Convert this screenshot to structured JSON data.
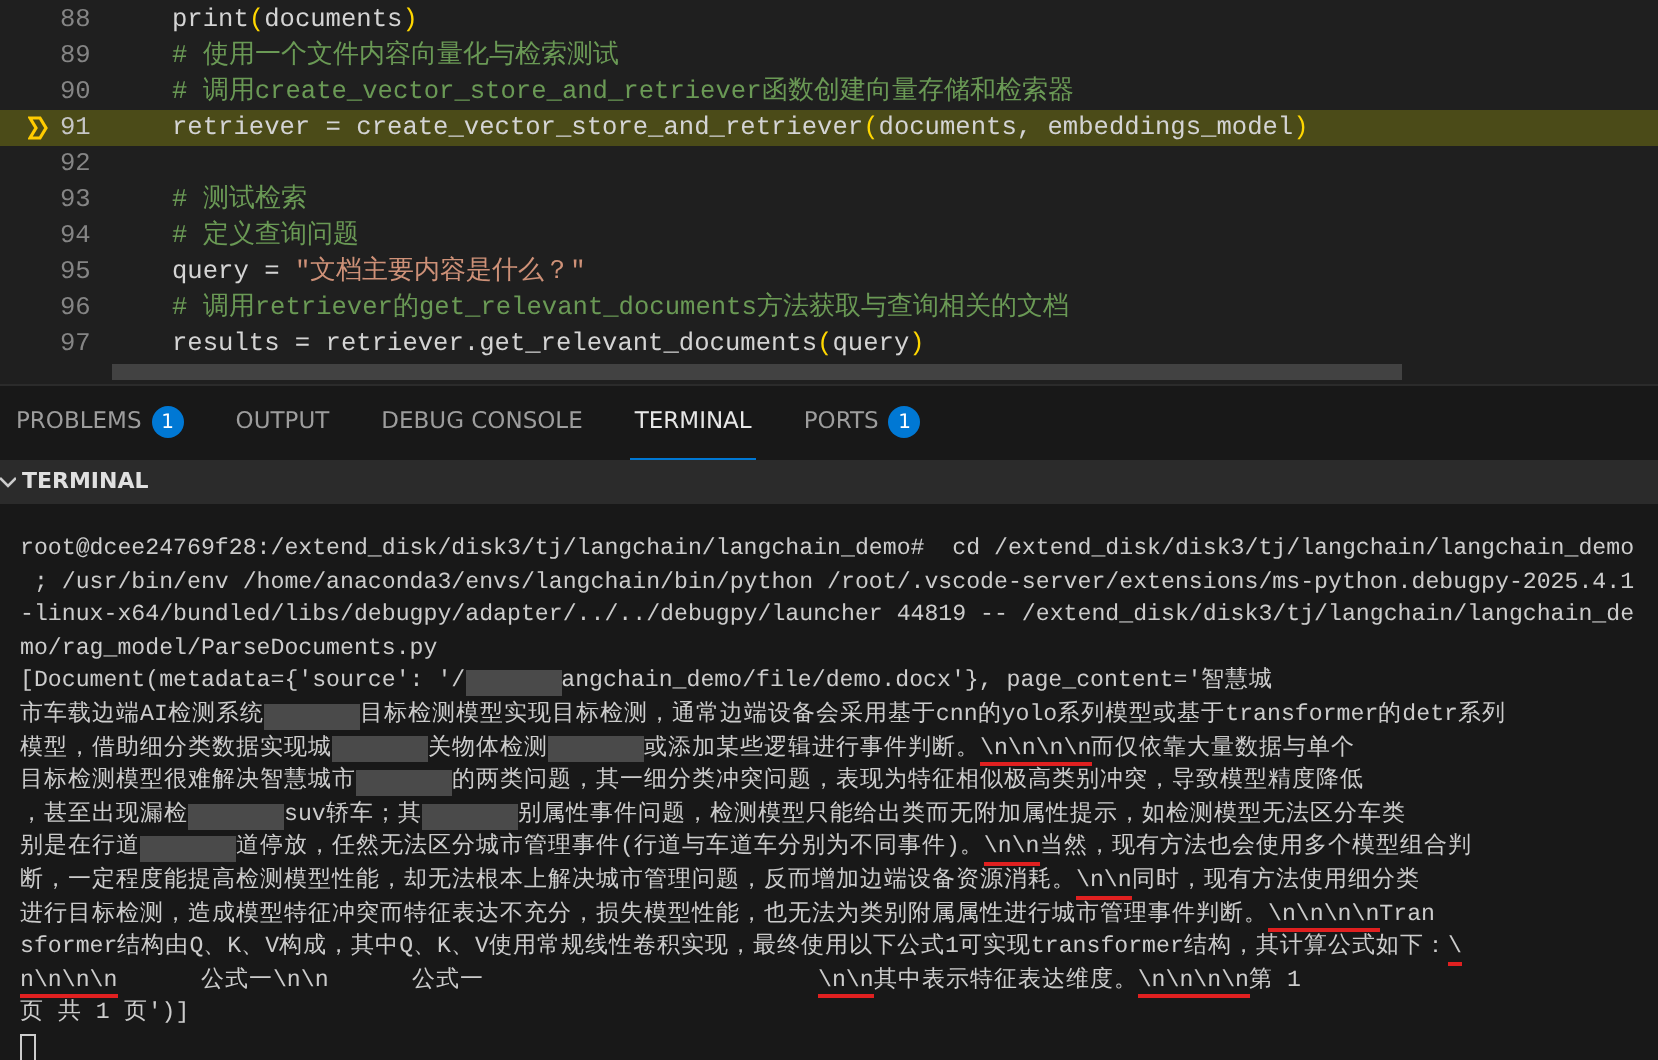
{
  "editor": {
    "lines": [
      {
        "number": "88",
        "current": false,
        "tokens": [
          {
            "kind": "plain",
            "text": "print"
          },
          {
            "kind": "paren",
            "text": "("
          },
          {
            "kind": "plain",
            "text": "documents"
          },
          {
            "kind": "paren",
            "text": ")"
          }
        ]
      },
      {
        "number": "89",
        "current": false,
        "tokens": [
          {
            "kind": "comment",
            "text": "# 使用一个文件内容向量化与检索测试"
          }
        ]
      },
      {
        "number": "90",
        "current": false,
        "tokens": [
          {
            "kind": "comment",
            "text": "# 调用create_vector_store_and_retriever函数创建向量存储和检索器"
          }
        ]
      },
      {
        "number": "91",
        "current": true,
        "tokens": [
          {
            "kind": "plain",
            "text": "retriever = create_vector_store_and_retriever"
          },
          {
            "kind": "paren",
            "text": "("
          },
          {
            "kind": "plain",
            "text": "documents, embeddings_model"
          },
          {
            "kind": "paren",
            "text": ")"
          }
        ]
      },
      {
        "number": "92",
        "current": false
      },
      {
        "number": "93",
        "current": false,
        "tokens": [
          {
            "kind": "comment",
            "text": "# 测试检索"
          }
        ]
      },
      {
        "number": "94",
        "current": false,
        "tokens": [
          {
            "kind": "comment",
            "text": "# 定义查询问题"
          }
        ]
      },
      {
        "number": "95",
        "current": false,
        "tokens": [
          {
            "kind": "plain",
            "text": "query = "
          },
          {
            "kind": "string",
            "text": "\"文档主要内容是什么？\""
          }
        ]
      },
      {
        "number": "96",
        "current": false,
        "tokens": [
          {
            "kind": "comment",
            "text": "# 调用retriever的get_relevant_documents方法获取与查询相关的文档"
          }
        ]
      },
      {
        "number": "97",
        "current": false,
        "tokens": [
          {
            "kind": "plain",
            "text": "results = retriever.get_relevant_documents"
          },
          {
            "kind": "paren",
            "text": "("
          },
          {
            "kind": "plain",
            "text": "query"
          },
          {
            "kind": "paren",
            "text": ")"
          }
        ]
      }
    ]
  },
  "panel_tabs": [
    {
      "label": "PROBLEMS",
      "badge": "1",
      "selected": false
    },
    {
      "label": "OUTPUT",
      "selected": false
    },
    {
      "label": "DEBUG CONSOLE",
      "selected": false
    },
    {
      "label": "TERMINAL",
      "selected": true
    },
    {
      "label": "PORTS",
      "badge": "1",
      "selected": false
    }
  ],
  "section": {
    "title": "TERMINAL",
    "expanded": true
  },
  "terminal": {
    "lines": [
      [
        {
          "kind": "text",
          "text": "root@dcee24769f28:/extend_disk/disk3/tj/langchain/langchain_demo#  cd /extend_disk/disk3/tj/langchain/langchain_demo"
        }
      ],
      [
        {
          "kind": "text",
          "text": " ; /usr/bin/env /home/anaconda3/envs/langchain/bin/python /root/.vscode-server/extensions/ms-python.debugpy-2025.4.1"
        }
      ],
      [
        {
          "kind": "text",
          "text": "-linux-x64/bundled/libs/debugpy/adapter/../../debugpy/launcher 44819 -- /extend_disk/disk3/tj/langchain/langchain_de"
        }
      ],
      [
        {
          "kind": "text",
          "text": "mo/rag_model/ParseDocuments.py"
        }
      ],
      [
        {
          "kind": "text",
          "text": "[Document(metadata={'source': '/"
        },
        {
          "kind": "blur"
        },
        {
          "kind": "text",
          "text": "angchain_demo/file/demo.docx'}, page_content='智慧城"
        }
      ],
      [
        {
          "kind": "text",
          "text": "市车载边端AI检测系统"
        },
        {
          "kind": "blur"
        },
        {
          "kind": "text",
          "text": "目标检测模型实现目标检测，通常边端设备会采用基于cnn的yolo系列模型或基于transformer的detr系列"
        }
      ],
      [
        {
          "kind": "text",
          "text": "模型，借助细分类数据实现城"
        },
        {
          "kind": "blur"
        },
        {
          "kind": "text",
          "text": "关物体检测"
        },
        {
          "kind": "blur"
        },
        {
          "kind": "text",
          "text": "或添加某些逻辑进行事件判断。"
        },
        {
          "kind": "text",
          "text": "\\n\\n\\n\\n",
          "marked": true
        },
        {
          "kind": "text",
          "text": "而仅依靠大量数据与单个"
        }
      ],
      [
        {
          "kind": "text",
          "text": "目标检测模型很难解决智慧城市"
        },
        {
          "kind": "blur"
        },
        {
          "kind": "text",
          "text": "的两类问题，其一细分类冲突问题，表现为特征相似极高类别冲突，导致模型精度降低"
        }
      ],
      [
        {
          "kind": "text",
          "text": "，甚至出现漏检"
        },
        {
          "kind": "blur"
        },
        {
          "kind": "text",
          "text": "suv轿车；其"
        },
        {
          "kind": "blur"
        },
        {
          "kind": "text",
          "text": "别属性事件问题，检测模型只能给出类而无附加属性提示，如检测模型无法区分车类"
        }
      ],
      [
        {
          "kind": "text",
          "text": "别是在行道"
        },
        {
          "kind": "blur"
        },
        {
          "kind": "text",
          "text": "道停放，任然无法区分城市管理事件(行道与车道车分别为不同事件)。"
        },
        {
          "kind": "text",
          "text": "\\n\\n",
          "marked": true
        },
        {
          "kind": "text",
          "text": "当然，现有方法也会使用多个模型组合判"
        }
      ],
      [
        {
          "kind": "text",
          "text": "断，一定程度能提高检测模型性能，却无法根本上解决城市管理问题，反而增加边端设备资源消耗。"
        },
        {
          "kind": "text",
          "text": "\\n\\n",
          "marked": true
        },
        {
          "kind": "text",
          "text": "同时，现有方法使用细分类"
        }
      ],
      [
        {
          "kind": "text",
          "text": "进行目标检测，造成模型特征冲突而特征表达不充分，损失模型性能，也无法为类别附属属性进行城市管理事件判断。"
        },
        {
          "kind": "text",
          "text": "\\n\\n\\n\\n",
          "marked": true
        },
        {
          "kind": "text",
          "text": "Tran"
        }
      ],
      [
        {
          "kind": "text",
          "text": "sformer结构由Q、K、V构成，其中Q、K、V使用常规线性卷积实现，最终使用以下公式1可实现transformer结构，其计算公式如下："
        },
        {
          "kind": "text",
          "text": "\\",
          "marked": true
        }
      ],
      [
        {
          "kind": "text",
          "text": "n\\n\\n\\n",
          "marked": true
        },
        {
          "kind": "text",
          "text": "      公式一\\n\\n      公式一                        "
        },
        {
          "kind": "text",
          "text": "\\n\\n",
          "marked": true
        },
        {
          "kind": "text",
          "text": "其中表示特征表达维度。"
        },
        {
          "kind": "text",
          "text": "\\n\\n\\n\\n",
          "marked": true
        },
        {
          "kind": "text",
          "text": "第 1"
        }
      ],
      [
        {
          "kind": "text",
          "text": "页 共 1 页')]"
        }
      ]
    ]
  }
}
